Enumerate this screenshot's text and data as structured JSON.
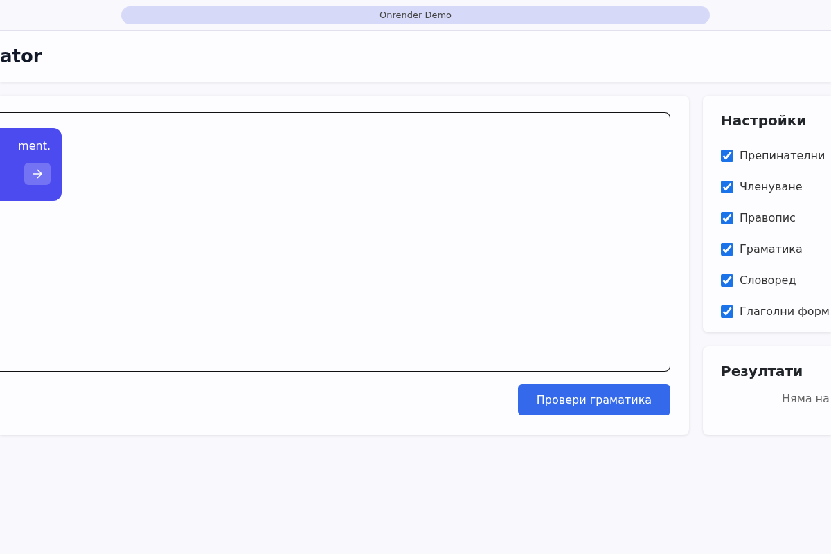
{
  "top_bar": {
    "title": "Onrender Demo"
  },
  "header": {
    "title": "ator"
  },
  "editor": {
    "tooltip": {
      "text": "ment."
    },
    "check_button": "Провери граматика"
  },
  "settings": {
    "title": "Настройки",
    "options": [
      {
        "label": "Препинателни",
        "checked": true
      },
      {
        "label": "Членуване",
        "checked": true
      },
      {
        "label": "Правопис",
        "checked": true
      },
      {
        "label": "Граматика",
        "checked": true
      },
      {
        "label": "Словоред",
        "checked": true
      },
      {
        "label": "Глаголни форм",
        "checked": true
      }
    ]
  },
  "results": {
    "title": "Резултати",
    "empty_text": "Няма на"
  }
}
